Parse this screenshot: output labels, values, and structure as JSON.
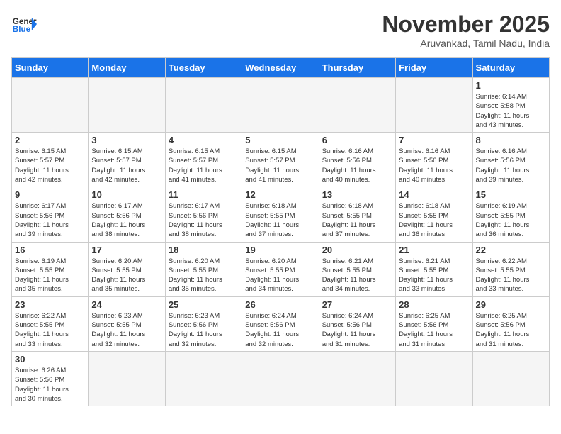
{
  "logo": {
    "text_general": "General",
    "text_blue": "Blue"
  },
  "title": "November 2025",
  "subtitle": "Aruvankad, Tamil Nadu, India",
  "weekdays": [
    "Sunday",
    "Monday",
    "Tuesday",
    "Wednesday",
    "Thursday",
    "Friday",
    "Saturday"
  ],
  "days": [
    {
      "num": "",
      "empty": true,
      "info": ""
    },
    {
      "num": "",
      "empty": true,
      "info": ""
    },
    {
      "num": "",
      "empty": true,
      "info": ""
    },
    {
      "num": "",
      "empty": true,
      "info": ""
    },
    {
      "num": "",
      "empty": true,
      "info": ""
    },
    {
      "num": "",
      "empty": true,
      "info": ""
    },
    {
      "num": "1",
      "empty": false,
      "info": "Sunrise: 6:14 AM\nSunset: 5:58 PM\nDaylight: 11 hours\nand 43 minutes."
    },
    {
      "num": "2",
      "empty": false,
      "info": "Sunrise: 6:15 AM\nSunset: 5:57 PM\nDaylight: 11 hours\nand 42 minutes."
    },
    {
      "num": "3",
      "empty": false,
      "info": "Sunrise: 6:15 AM\nSunset: 5:57 PM\nDaylight: 11 hours\nand 42 minutes."
    },
    {
      "num": "4",
      "empty": false,
      "info": "Sunrise: 6:15 AM\nSunset: 5:57 PM\nDaylight: 11 hours\nand 41 minutes."
    },
    {
      "num": "5",
      "empty": false,
      "info": "Sunrise: 6:15 AM\nSunset: 5:57 PM\nDaylight: 11 hours\nand 41 minutes."
    },
    {
      "num": "6",
      "empty": false,
      "info": "Sunrise: 6:16 AM\nSunset: 5:56 PM\nDaylight: 11 hours\nand 40 minutes."
    },
    {
      "num": "7",
      "empty": false,
      "info": "Sunrise: 6:16 AM\nSunset: 5:56 PM\nDaylight: 11 hours\nand 40 minutes."
    },
    {
      "num": "8",
      "empty": false,
      "info": "Sunrise: 6:16 AM\nSunset: 5:56 PM\nDaylight: 11 hours\nand 39 minutes."
    },
    {
      "num": "9",
      "empty": false,
      "info": "Sunrise: 6:17 AM\nSunset: 5:56 PM\nDaylight: 11 hours\nand 39 minutes."
    },
    {
      "num": "10",
      "empty": false,
      "info": "Sunrise: 6:17 AM\nSunset: 5:56 PM\nDaylight: 11 hours\nand 38 minutes."
    },
    {
      "num": "11",
      "empty": false,
      "info": "Sunrise: 6:17 AM\nSunset: 5:56 PM\nDaylight: 11 hours\nand 38 minutes."
    },
    {
      "num": "12",
      "empty": false,
      "info": "Sunrise: 6:18 AM\nSunset: 5:55 PM\nDaylight: 11 hours\nand 37 minutes."
    },
    {
      "num": "13",
      "empty": false,
      "info": "Sunrise: 6:18 AM\nSunset: 5:55 PM\nDaylight: 11 hours\nand 37 minutes."
    },
    {
      "num": "14",
      "empty": false,
      "info": "Sunrise: 6:18 AM\nSunset: 5:55 PM\nDaylight: 11 hours\nand 36 minutes."
    },
    {
      "num": "15",
      "empty": false,
      "info": "Sunrise: 6:19 AM\nSunset: 5:55 PM\nDaylight: 11 hours\nand 36 minutes."
    },
    {
      "num": "16",
      "empty": false,
      "info": "Sunrise: 6:19 AM\nSunset: 5:55 PM\nDaylight: 11 hours\nand 35 minutes."
    },
    {
      "num": "17",
      "empty": false,
      "info": "Sunrise: 6:20 AM\nSunset: 5:55 PM\nDaylight: 11 hours\nand 35 minutes."
    },
    {
      "num": "18",
      "empty": false,
      "info": "Sunrise: 6:20 AM\nSunset: 5:55 PM\nDaylight: 11 hours\nand 35 minutes."
    },
    {
      "num": "19",
      "empty": false,
      "info": "Sunrise: 6:20 AM\nSunset: 5:55 PM\nDaylight: 11 hours\nand 34 minutes."
    },
    {
      "num": "20",
      "empty": false,
      "info": "Sunrise: 6:21 AM\nSunset: 5:55 PM\nDaylight: 11 hours\nand 34 minutes."
    },
    {
      "num": "21",
      "empty": false,
      "info": "Sunrise: 6:21 AM\nSunset: 5:55 PM\nDaylight: 11 hours\nand 33 minutes."
    },
    {
      "num": "22",
      "empty": false,
      "info": "Sunrise: 6:22 AM\nSunset: 5:55 PM\nDaylight: 11 hours\nand 33 minutes."
    },
    {
      "num": "23",
      "empty": false,
      "info": "Sunrise: 6:22 AM\nSunset: 5:55 PM\nDaylight: 11 hours\nand 33 minutes."
    },
    {
      "num": "24",
      "empty": false,
      "info": "Sunrise: 6:23 AM\nSunset: 5:55 PM\nDaylight: 11 hours\nand 32 minutes."
    },
    {
      "num": "25",
      "empty": false,
      "info": "Sunrise: 6:23 AM\nSunset: 5:56 PM\nDaylight: 11 hours\nand 32 minutes."
    },
    {
      "num": "26",
      "empty": false,
      "info": "Sunrise: 6:24 AM\nSunset: 5:56 PM\nDaylight: 11 hours\nand 32 minutes."
    },
    {
      "num": "27",
      "empty": false,
      "info": "Sunrise: 6:24 AM\nSunset: 5:56 PM\nDaylight: 11 hours\nand 31 minutes."
    },
    {
      "num": "28",
      "empty": false,
      "info": "Sunrise: 6:25 AM\nSunset: 5:56 PM\nDaylight: 11 hours\nand 31 minutes."
    },
    {
      "num": "29",
      "empty": false,
      "info": "Sunrise: 6:25 AM\nSunset: 5:56 PM\nDaylight: 11 hours\nand 31 minutes."
    },
    {
      "num": "30",
      "empty": false,
      "info": "Sunrise: 6:26 AM\nSunset: 5:56 PM\nDaylight: 11 hours\nand 30 minutes."
    }
  ]
}
